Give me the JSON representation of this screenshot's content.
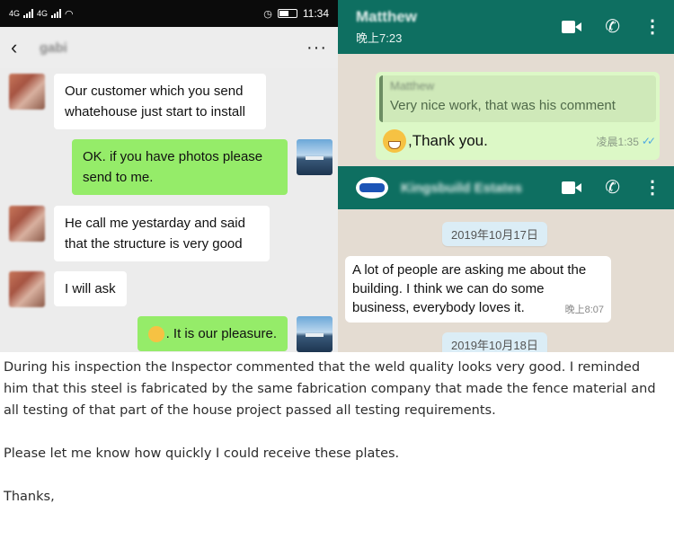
{
  "wechat": {
    "status": {
      "time": "11:34",
      "carrier1": "4G",
      "carrier2": "4G"
    },
    "contact_name": "gabi",
    "messages": [
      {
        "from": "them",
        "text": "Our customer which you send whatehouse just start to install"
      },
      {
        "from": "me",
        "text": "OK. if you have photos please send to me."
      },
      {
        "from": "them",
        "text": "He call me yestarday and said that the structure is very good"
      },
      {
        "from": "them",
        "text": "I will ask"
      },
      {
        "from": "me",
        "text": ". It is our pleasure."
      }
    ]
  },
  "whatsapp": {
    "chat1": {
      "contact_name": "Matthew",
      "last_seen": "晚上7:23",
      "quoted_name": "Matthew",
      "quoted_text": "Very nice work, that was his comment",
      "reply_text": ",Thank you.",
      "reply_time": "凌晨1:35",
      "tick_color": "#4fa9e2"
    },
    "chat2": {
      "contact_name": "Kingsbuild Estates",
      "date1": "2019年10月17日",
      "message": "A lot of people are asking me about the building. I think we can do some business, everybody loves it.",
      "message_time": "晚上8:07",
      "date2": "2019年10月18日"
    },
    "header_color": "#0e6f61"
  },
  "email": {
    "paragraph1": "During his inspection the Inspector commented that the weld quality looks very good.  I reminded him that this steel is fabricated by the same fabrication company that made the fence material and all testing of that part of the house project passed all testing requirements.",
    "paragraph2": "Please let me know how quickly I could receive these plates.",
    "closing": "Thanks,"
  }
}
